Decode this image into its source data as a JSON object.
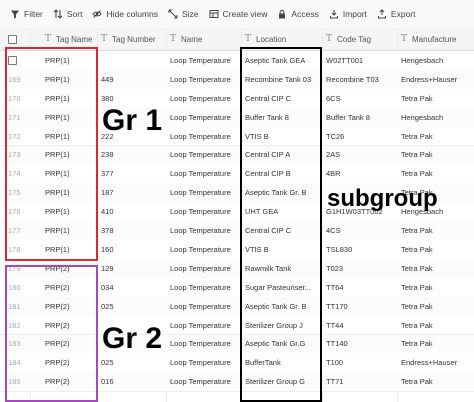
{
  "toolbar": {
    "filter": "Filter",
    "sort": "Sort",
    "hide_columns": "Hide columns",
    "size": "Size",
    "create_view": "Create view",
    "access": "Access",
    "import": "Import",
    "export": "Export"
  },
  "columns": [
    "Tag Name",
    "Tag Number",
    "Name",
    "Location",
    "Code Tag",
    "Manufacture"
  ],
  "rows": [
    {
      "n": "",
      "tag": "PRP(1)",
      "num": "",
      "name": "Loop Temperature",
      "loc": "Aseptic Tank GEA",
      "code": "W02TT001",
      "mfr": "Hengesbach"
    },
    {
      "n": "169",
      "tag": "PRP(1)",
      "num": "449",
      "name": "Loop Temperature",
      "loc": "Recombine Tank 03",
      "code": "Recombine T03",
      "mfr": "Endress+Hauser"
    },
    {
      "n": "170",
      "tag": "PRP(1)",
      "num": "380",
      "name": "Loop Temperature",
      "loc": "Central CIP C",
      "code": "6CS",
      "mfr": "Tetra Pak"
    },
    {
      "n": "171",
      "tag": "PRP(1)",
      "num": "",
      "name": "Loop Temperature",
      "loc": "Buffer Tank 8",
      "code": "Buffer Tank 8",
      "mfr": "Hengesbach"
    },
    {
      "n": "172",
      "tag": "PRP(1)",
      "num": "222",
      "name": "Loop Temperature",
      "loc": "VTIS B",
      "code": "TC26",
      "mfr": "Tetra Pak"
    },
    {
      "n": "173",
      "tag": "PRP(1)",
      "num": "238",
      "name": "Loop Temperature",
      "loc": "Central CIP A",
      "code": "2AS",
      "mfr": "Tetra Pak"
    },
    {
      "n": "174",
      "tag": "PRP(1)",
      "num": "377",
      "name": "Loop Temperature",
      "loc": "Central CIP B",
      "code": "4BR",
      "mfr": "Tetra Pak"
    },
    {
      "n": "175",
      "tag": "PRP(1)",
      "num": "187",
      "name": "Loop Temperature",
      "loc": "Aseptic Tank Gr. B",
      "code": "",
      "mfr": "Tetra Pak"
    },
    {
      "n": "176",
      "tag": "PRP(1)",
      "num": "410",
      "name": "Loop Temperature",
      "loc": "UHT GEA",
      "code": "G1H1W03TT002",
      "mfr": "Hengesbach"
    },
    {
      "n": "177",
      "tag": "PRP(1)",
      "num": "378",
      "name": "Loop Temperature",
      "loc": "Central CIP C",
      "code": "4CS",
      "mfr": "Tetra Pak"
    },
    {
      "n": "178",
      "tag": "PRP(1)",
      "num": "160",
      "name": "Loop Temperature",
      "loc": "VTIS B",
      "code": "TSL830",
      "mfr": "Tetra Pak"
    },
    {
      "n": "179",
      "tag": "PRP(2)",
      "num": "129",
      "name": "Loop Temperature",
      "loc": "Rawmilk Tank",
      "code": "T023",
      "mfr": "Tetra Pak"
    },
    {
      "n": "180",
      "tag": "PRP(2)",
      "num": "034",
      "name": "Loop Temperature",
      "loc": "Sugar Pasteuriser...",
      "code": "TT64",
      "mfr": "Tetra Pak"
    },
    {
      "n": "181",
      "tag": "PRP(2)",
      "num": "025",
      "name": "Loop Temperature",
      "loc": "Aseptic Tank Gr. B",
      "code": "TT170",
      "mfr": "Tetra Pak"
    },
    {
      "n": "182",
      "tag": "PRP(2)",
      "num": "",
      "name": "Loop Temperature",
      "loc": "Sterilizer Group J",
      "code": "TT44",
      "mfr": "Tetra Pak"
    },
    {
      "n": "183",
      "tag": "PRP(2)",
      "num": "",
      "name": "Loop Temperature",
      "loc": "Aseptic Tank Gr.G",
      "code": "TT140",
      "mfr": "Tetra Pak"
    },
    {
      "n": "184",
      "tag": "PRP(2)",
      "num": "025",
      "name": "Loop Temperature",
      "loc": "BufferTank",
      "code": "T100",
      "mfr": "Endress+Hauser"
    },
    {
      "n": "185",
      "tag": "PRP(2)",
      "num": "016",
      "name": "Loop Temperature",
      "loc": "Sterilizer Group G",
      "code": "TT71",
      "mfr": "Tetra Pak"
    }
  ],
  "annotations": {
    "group1": "Gr 1",
    "group2": "Gr 2",
    "subgroup": "subgroup"
  },
  "colors": {
    "group1_box": "#e0262e",
    "group2_box": "#a24bb8",
    "subgroup_box": "#000000"
  }
}
